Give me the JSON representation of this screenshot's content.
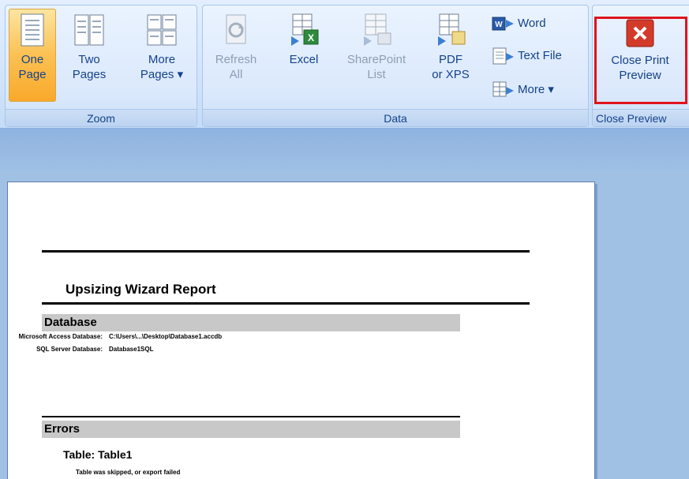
{
  "ribbon": {
    "zoom": {
      "group_label": "Zoom",
      "one_page": {
        "line1": "One",
        "line2": "Page"
      },
      "two_pages": {
        "line1": "Two",
        "line2": "Pages"
      },
      "more_pages": {
        "line1": "More",
        "line2": "Pages ▾"
      }
    },
    "data": {
      "group_label": "Data",
      "refresh_all": {
        "line1": "Refresh",
        "line2": "All"
      },
      "excel": {
        "line1": "Excel"
      },
      "sharepoint_list": {
        "line1": "SharePoint",
        "line2": "List"
      },
      "pdf_xps": {
        "line1": "PDF",
        "line2": "or XPS"
      },
      "word": "Word",
      "text_file": "Text File",
      "more": "More ▾"
    },
    "close": {
      "group_label": "Close Preview",
      "close_print_preview": {
        "line1": "Close Print",
        "line2": "Preview"
      }
    }
  },
  "report": {
    "title": "Upsizing Wizard Report",
    "database_section": "Database",
    "access_db_key": "Microsoft Access Database:",
    "access_db_value": "C:\\Users\\...\\Desktop\\Database1.accdb",
    "sql_db_key": "SQL Server Database:",
    "sql_db_value": "Database1SQL",
    "errors_section": "Errors",
    "table_heading": "Table: Table1",
    "table_note": "Table was skipped, or export failed"
  },
  "colors": {
    "ribbon_text": "#15428b",
    "selected_button": "#fbc153",
    "highlight": "#e0141b"
  }
}
